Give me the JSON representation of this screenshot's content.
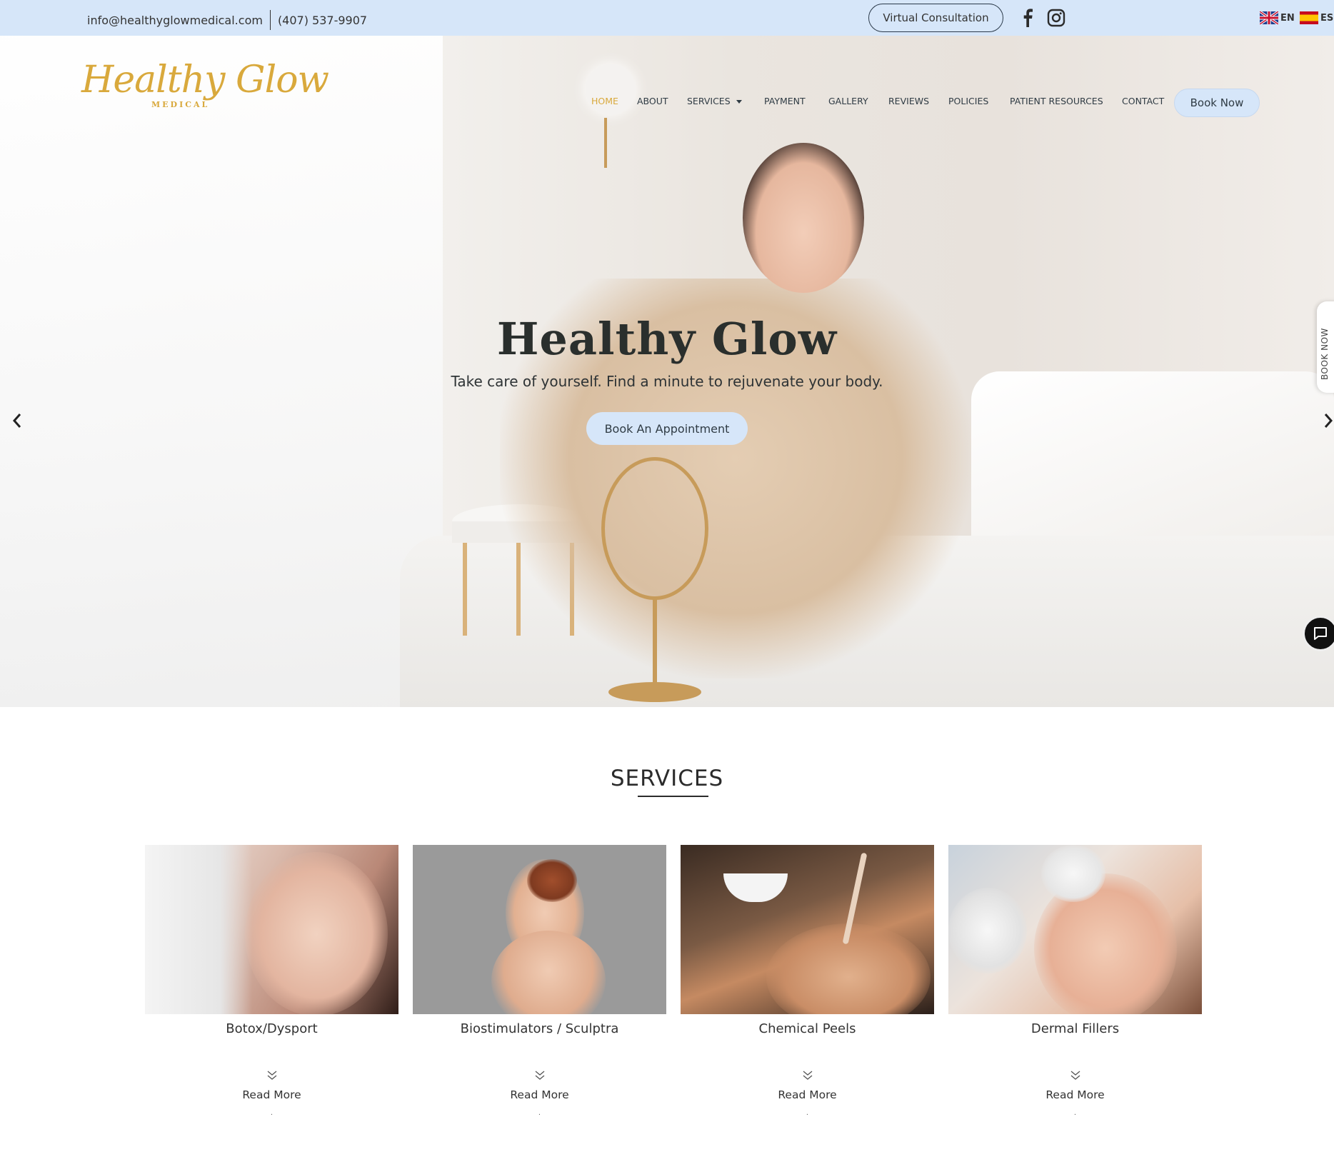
{
  "topbar": {
    "email": "info@healthyglowmedical.com",
    "phone": "(407) 537-9907",
    "virtual_consultation": "Virtual Consultation",
    "lang_en": "EN",
    "lang_es": "ES"
  },
  "logo": {
    "script": "Healthy Glow",
    "sub": "MEDICAL"
  },
  "nav": {
    "items": [
      "HOME",
      "ABOUT",
      "SERVICES",
      "PAYMENT",
      "GALLERY",
      "REVIEWS",
      "POLICIES",
      "PATIENT RESOURCES",
      "CONTACT"
    ],
    "book_now": "Book Now"
  },
  "hero": {
    "title": "Healthy Glow",
    "subtitle": "Take care of yourself. Find a minute to rejuvenate your body.",
    "button": "Book An Appointment"
  },
  "side_tab": "BOOK NOW",
  "services": {
    "title": "SERVICES",
    "cards": [
      {
        "name": "Botox/Dysport",
        "more": "Read More"
      },
      {
        "name": "Biostimulators / Sculptra",
        "more": "Read More"
      },
      {
        "name": "Chemical Peels",
        "more": "Read More"
      },
      {
        "name": "Dermal Fillers",
        "more": "Read More"
      }
    ]
  },
  "colors": {
    "topbar_bg": "#d6e6f9",
    "accent_gold": "#d9a93c",
    "button_bg": "#d6e6f9"
  },
  "icons": [
    "facebook-icon",
    "instagram-icon",
    "uk-flag-icon",
    "spain-flag-icon",
    "chevron-left-icon",
    "chevron-right-icon",
    "chat-icon",
    "double-chevron-down-icon"
  ]
}
